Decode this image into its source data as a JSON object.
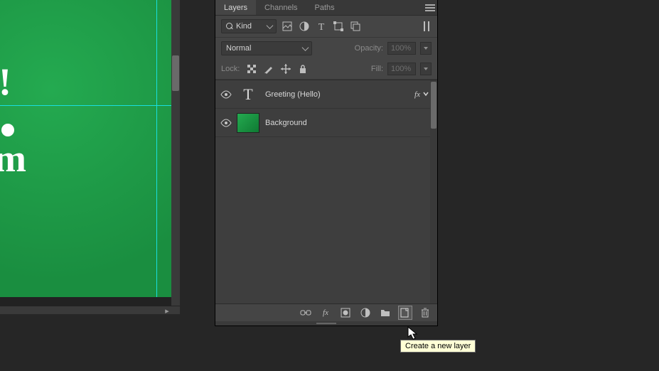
{
  "tabs": {
    "layers": "Layers",
    "channels": "Channels",
    "paths": "Paths"
  },
  "filter": {
    "kind": "Kind"
  },
  "blend": {
    "mode": "Normal",
    "opacity_label": "Opacity:",
    "opacity": "100%"
  },
  "lock": {
    "label": "Lock:",
    "fill_label": "Fill:",
    "fill": "100%"
  },
  "layers": [
    {
      "name": "Greeting (Hello)",
      "fx": "fx"
    },
    {
      "name": "Background"
    }
  ],
  "tooltip": "Create a new layer",
  "canvas_letters": {
    "excl": "!",
    "m": "m"
  }
}
